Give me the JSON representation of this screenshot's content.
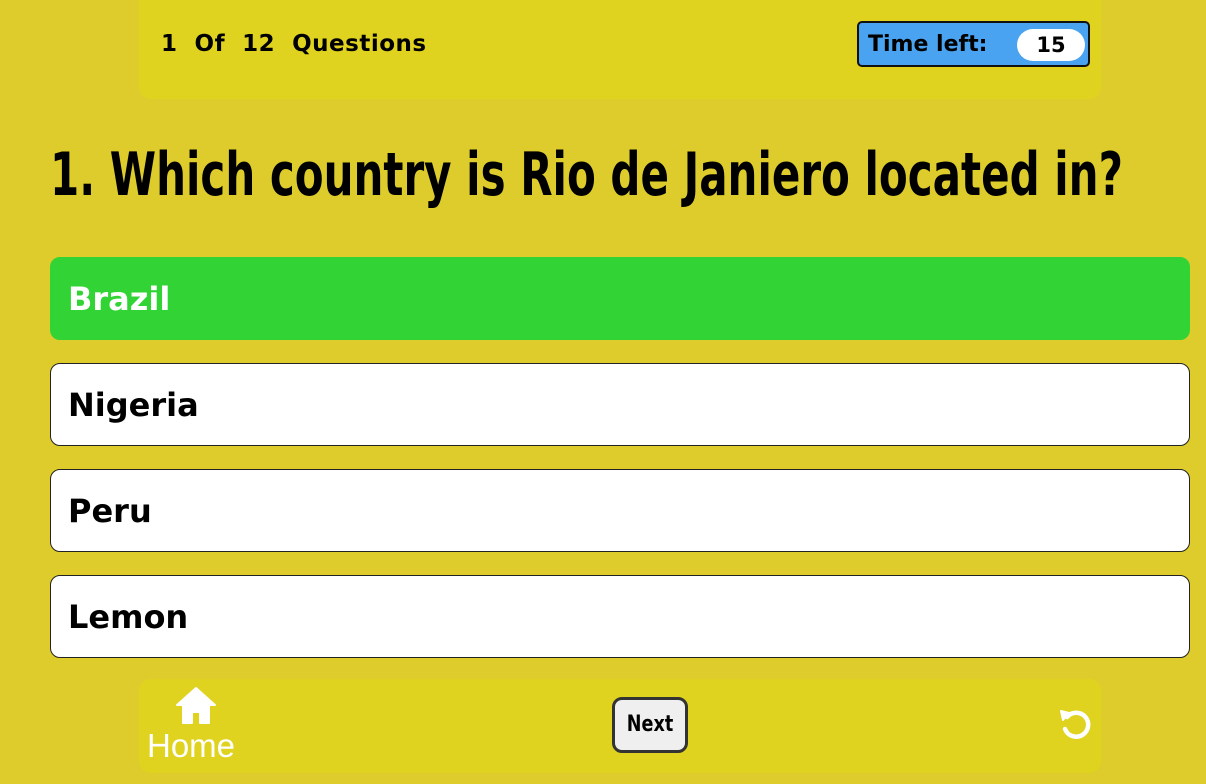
{
  "header": {
    "progress": "1  Of  12  Questions",
    "timer_label": "Time left:",
    "timer_value": "15"
  },
  "question": {
    "text": "1. Which country is Rio de Janiero located in?"
  },
  "answers": [
    {
      "label": "Brazil",
      "state": "correct"
    },
    {
      "label": "Nigeria",
      "state": "default"
    },
    {
      "label": "Peru",
      "state": "default"
    },
    {
      "label": "Lemon",
      "state": "default"
    }
  ],
  "footer": {
    "home_label": "Home",
    "home_icon": "home-icon",
    "next_label": "Next",
    "restart_icon": "restart-icon"
  },
  "colors": {
    "background": "#DECC2C",
    "bar": "#DFD31F",
    "timer": "#4AA3F0",
    "correct": "#32D435"
  }
}
